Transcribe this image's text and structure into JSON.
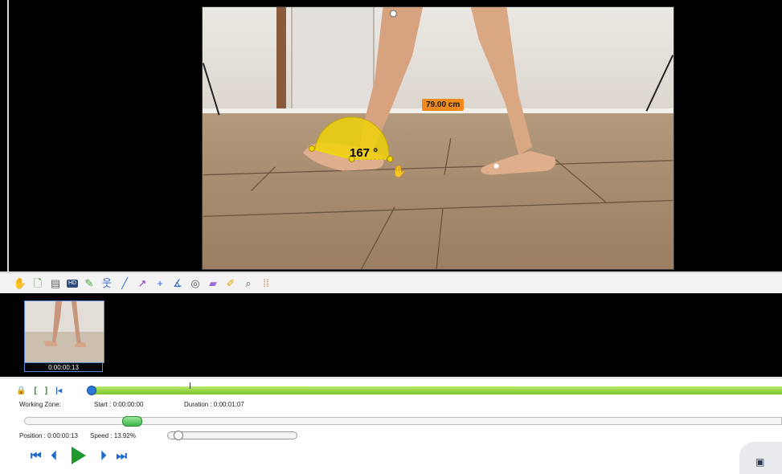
{
  "overlay": {
    "distance_label": "79.00 cm",
    "angle_label": "167 °"
  },
  "toolbar": {
    "tools": [
      "hand-icon",
      "new-document-icon",
      "notes-icon",
      "hd-icon",
      "pencil-icon",
      "posture-icon",
      "line-icon",
      "arrow-icon",
      "cross-marker-icon",
      "angle-icon",
      "chronometer-icon",
      "magnifier-icon",
      "grid-icon"
    ]
  },
  "thumbnails": [
    {
      "timestamp": "0:00:00:13"
    }
  ],
  "working_zone": {
    "label": "Working Zone:",
    "start": "Start : 0:00:00:00",
    "duration": "Duration : 0:00:01:07"
  },
  "playback": {
    "position": "Position : 0:00:00:13",
    "speed": "Speed : 13.92%",
    "position_fraction": 0.16,
    "speed_fraction": 0.12
  },
  "colors": {
    "accent_green": "#7cc42c",
    "play_green": "#1e9a2c",
    "angle_yellow": "#f2d600",
    "label_orange": "#f08a1e"
  }
}
